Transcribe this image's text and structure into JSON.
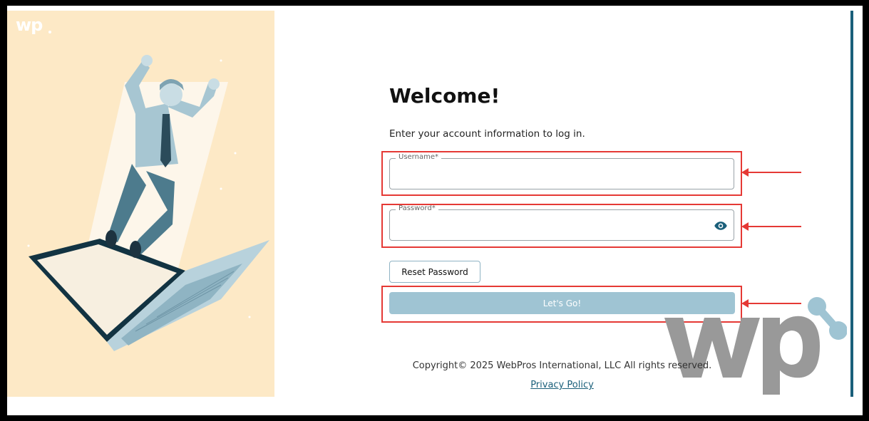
{
  "branding": {
    "corner_logo": "wp",
    "accent_color": "#1a5f7a",
    "panel_color": "#fde9c6"
  },
  "login": {
    "title": "Welcome!",
    "subtitle": "Enter your account information to log in.",
    "username_label": "Username*",
    "username_value": "",
    "password_label": "Password*",
    "password_value": "",
    "password_toggle_icon": "eye-icon",
    "reset_label": "Reset Password",
    "submit_label": "Let's Go!"
  },
  "footer": {
    "copyright": "Copyright© 2025 WebPros International, LLC All rights reserved.",
    "privacy_link": "Privacy Policy"
  },
  "annotations": {
    "highlight_color": "#e53935"
  }
}
